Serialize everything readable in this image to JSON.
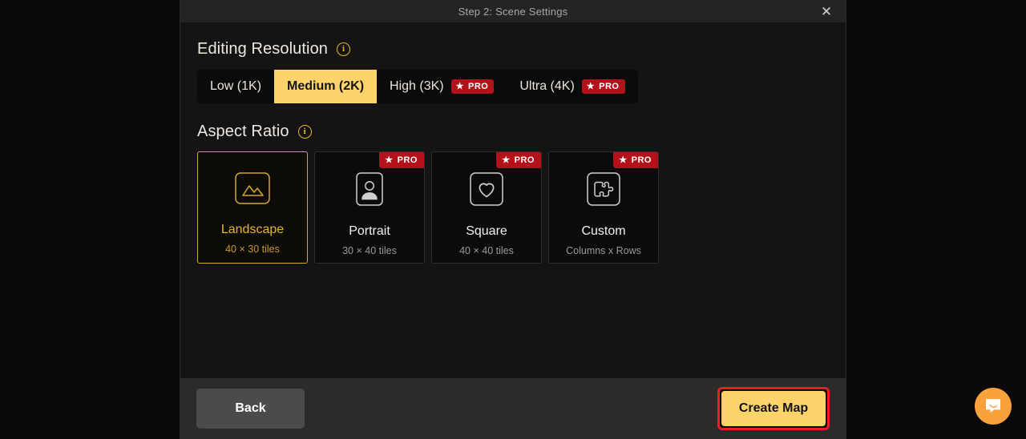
{
  "window": {
    "title": "Step 2: Scene Settings",
    "close_label": "✕"
  },
  "resolution": {
    "heading": "Editing Resolution",
    "info_glyph": "i",
    "options": [
      {
        "label": "Low (1K)",
        "pro": false,
        "selected": false
      },
      {
        "label": "Medium (2K)",
        "pro": false,
        "selected": true
      },
      {
        "label": "High (3K)",
        "pro": true,
        "selected": false
      },
      {
        "label": "Ultra (4K)",
        "pro": true,
        "selected": false
      }
    ],
    "pro_label": "PRO",
    "pro_star": "★"
  },
  "aspect_ratio": {
    "heading": "Aspect Ratio",
    "info_glyph": "i",
    "pro_label": "PRO",
    "pro_star": "★",
    "cards": [
      {
        "label": "Landscape",
        "sub": "40 × 30 tiles",
        "icon": "image-icon",
        "pro": false,
        "selected": true
      },
      {
        "label": "Portrait",
        "sub": "30 × 40 tiles",
        "icon": "person-icon",
        "pro": true,
        "selected": false
      },
      {
        "label": "Square",
        "sub": "40 × 40 tiles",
        "icon": "heart-icon",
        "pro": true,
        "selected": false
      },
      {
        "label": "Custom",
        "sub": "Columns x Rows",
        "icon": "puzzle-icon",
        "pro": true,
        "selected": false
      }
    ]
  },
  "footer": {
    "back_label": "Back",
    "create_label": "Create Map"
  },
  "chat": {
    "name": "intercom-launcher"
  },
  "colors": {
    "accent_gold": "#fcd469",
    "pro_red": "#b4121b",
    "highlight_red": "#ee1c24",
    "modal_bg": "#141414",
    "footer_bg": "#2b2b2b",
    "chat_orange": "#f9a13a"
  }
}
